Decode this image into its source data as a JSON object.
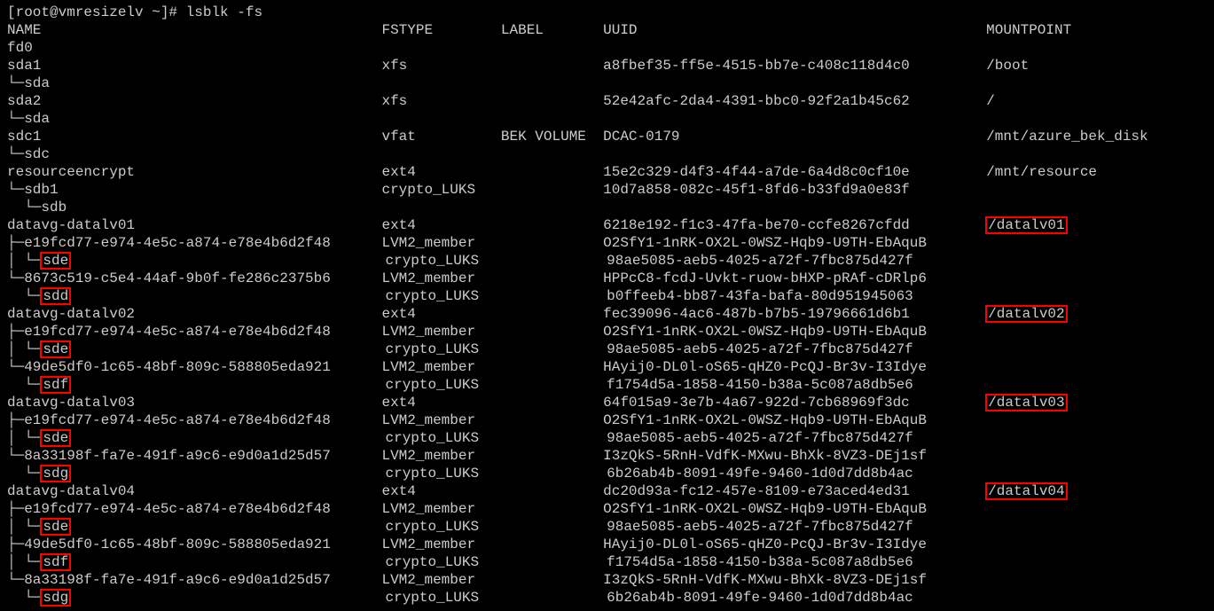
{
  "prompt": "[root@vmresizelv ~]# lsblk -fs",
  "header": {
    "name": "NAME",
    "fstype": "FSTYPE",
    "label": "LABEL",
    "uuid": "UUID",
    "mount": "MOUNTPOINT"
  },
  "rows": [
    {
      "tree": "fd0",
      "fstype": "",
      "label": "",
      "uuid": "",
      "mount": "",
      "hl_name": false,
      "hl_mount": false
    },
    {
      "tree": "sda1",
      "fstype": "xfs",
      "label": "",
      "uuid": "a8fbef35-ff5e-4515-bb7e-c408c118d4c0",
      "mount": "/boot",
      "hl_name": false,
      "hl_mount": false
    },
    {
      "tree": "└─sda",
      "fstype": "",
      "label": "",
      "uuid": "",
      "mount": "",
      "hl_name": false,
      "hl_mount": false
    },
    {
      "tree": "sda2",
      "fstype": "xfs",
      "label": "",
      "uuid": "52e42afc-2da4-4391-bbc0-92f2a1b45c62",
      "mount": "/",
      "hl_name": false,
      "hl_mount": false
    },
    {
      "tree": "└─sda",
      "fstype": "",
      "label": "",
      "uuid": "",
      "mount": "",
      "hl_name": false,
      "hl_mount": false
    },
    {
      "tree": "sdc1",
      "fstype": "vfat",
      "label": "BEK VOLUME",
      "uuid": "DCAC-0179",
      "mount": "/mnt/azure_bek_disk",
      "hl_name": false,
      "hl_mount": false
    },
    {
      "tree": "└─sdc",
      "fstype": "",
      "label": "",
      "uuid": "",
      "mount": "",
      "hl_name": false,
      "hl_mount": false
    },
    {
      "tree": "resourceencrypt",
      "fstype": "ext4",
      "label": "",
      "uuid": "15e2c329-d4f3-4f44-a7de-6a4d8c0cf10e",
      "mount": "/mnt/resource",
      "hl_name": false,
      "hl_mount": false
    },
    {
      "tree": "└─sdb1",
      "fstype": "crypto_LUKS",
      "label": "",
      "uuid": "10d7a858-082c-45f1-8fd6-b33fd9a0e83f",
      "mount": "",
      "hl_name": false,
      "hl_mount": false
    },
    {
      "tree": "  └─sdb",
      "fstype": "",
      "label": "",
      "uuid": "",
      "mount": "",
      "hl_name": false,
      "hl_mount": false
    },
    {
      "tree": "datavg-datalv01",
      "fstype": "ext4",
      "label": "",
      "uuid": "6218e192-f1c3-47fa-be70-ccfe8267cfdd",
      "mount": "/datalv01",
      "hl_name": false,
      "hl_mount": true
    },
    {
      "tree": "├─e19fcd77-e974-4e5c-a874-e78e4b6d2f48",
      "fstype": "LVM2_member",
      "label": "",
      "uuid": "O2SfY1-1nRK-OX2L-0WSZ-Hqb9-U9TH-EbAquB",
      "mount": "",
      "hl_name": false,
      "hl_mount": false
    },
    {
      "tree": "│ └─",
      "dev": "sde",
      "fstype": "crypto_LUKS",
      "label": "",
      "uuid": "98ae5085-aeb5-4025-a72f-7fbc875d427f",
      "mount": "",
      "hl_name": true,
      "hl_mount": false
    },
    {
      "tree": "└─8673c519-c5e4-44af-9b0f-fe286c2375b6",
      "fstype": "LVM2_member",
      "label": "",
      "uuid": "HPPcC8-fcdJ-Uvkt-ruow-bHXP-pRAf-cDRlp6",
      "mount": "",
      "hl_name": false,
      "hl_mount": false
    },
    {
      "tree": "  └─",
      "dev": "sdd",
      "fstype": "crypto_LUKS",
      "label": "",
      "uuid": "b0ffeeb4-bb87-43fa-bafa-80d951945063",
      "mount": "",
      "hl_name": true,
      "hl_mount": false
    },
    {
      "tree": "datavg-datalv02",
      "fstype": "ext4",
      "label": "",
      "uuid": "fec39096-4ac6-487b-b7b5-19796661d6b1",
      "mount": "/datalv02",
      "hl_name": false,
      "hl_mount": true
    },
    {
      "tree": "├─e19fcd77-e974-4e5c-a874-e78e4b6d2f48",
      "fstype": "LVM2_member",
      "label": "",
      "uuid": "O2SfY1-1nRK-OX2L-0WSZ-Hqb9-U9TH-EbAquB",
      "mount": "",
      "hl_name": false,
      "hl_mount": false
    },
    {
      "tree": "│ └─",
      "dev": "sde",
      "fstype": "crypto_LUKS",
      "label": "",
      "uuid": "98ae5085-aeb5-4025-a72f-7fbc875d427f",
      "mount": "",
      "hl_name": true,
      "hl_mount": false
    },
    {
      "tree": "└─49de5df0-1c65-48bf-809c-588805eda921",
      "fstype": "LVM2_member",
      "label": "",
      "uuid": "HAyij0-DL0l-oS65-qHZ0-PcQJ-Br3v-I3Idye",
      "mount": "",
      "hl_name": false,
      "hl_mount": false
    },
    {
      "tree": "  └─",
      "dev": "sdf",
      "fstype": "crypto_LUKS",
      "label": "",
      "uuid": "f1754d5a-1858-4150-b38a-5c087a8db5e6",
      "mount": "",
      "hl_name": true,
      "hl_mount": false
    },
    {
      "tree": "datavg-datalv03",
      "fstype": "ext4",
      "label": "",
      "uuid": "64f015a9-3e7b-4a67-922d-7cb68969f3dc",
      "mount": "/datalv03",
      "hl_name": false,
      "hl_mount": true
    },
    {
      "tree": "├─e19fcd77-e974-4e5c-a874-e78e4b6d2f48",
      "fstype": "LVM2_member",
      "label": "",
      "uuid": "O2SfY1-1nRK-OX2L-0WSZ-Hqb9-U9TH-EbAquB",
      "mount": "",
      "hl_name": false,
      "hl_mount": false
    },
    {
      "tree": "│ └─",
      "dev": "sde",
      "fstype": "crypto_LUKS",
      "label": "",
      "uuid": "98ae5085-aeb5-4025-a72f-7fbc875d427f",
      "mount": "",
      "hl_name": true,
      "hl_mount": false
    },
    {
      "tree": "└─8a33198f-fa7e-491f-a9c6-e9d0a1d25d57",
      "fstype": "LVM2_member",
      "label": "",
      "uuid": "I3zQkS-5RnH-VdfK-MXwu-BhXk-8VZ3-DEj1sf",
      "mount": "",
      "hl_name": false,
      "hl_mount": false
    },
    {
      "tree": "  └─",
      "dev": "sdg",
      "fstype": "crypto_LUKS",
      "label": "",
      "uuid": "6b26ab4b-8091-49fe-9460-1d0d7dd8b4ac",
      "mount": "",
      "hl_name": true,
      "hl_mount": false
    },
    {
      "tree": "datavg-datalv04",
      "fstype": "ext4",
      "label": "",
      "uuid": "dc20d93a-fc12-457e-8109-e73aced4ed31",
      "mount": "/datalv04",
      "hl_name": false,
      "hl_mount": true
    },
    {
      "tree": "├─e19fcd77-e974-4e5c-a874-e78e4b6d2f48",
      "fstype": "LVM2_member",
      "label": "",
      "uuid": "O2SfY1-1nRK-OX2L-0WSZ-Hqb9-U9TH-EbAquB",
      "mount": "",
      "hl_name": false,
      "hl_mount": false
    },
    {
      "tree": "│ └─",
      "dev": "sde",
      "fstype": "crypto_LUKS",
      "label": "",
      "uuid": "98ae5085-aeb5-4025-a72f-7fbc875d427f",
      "mount": "",
      "hl_name": true,
      "hl_mount": false
    },
    {
      "tree": "├─49de5df0-1c65-48bf-809c-588805eda921",
      "fstype": "LVM2_member",
      "label": "",
      "uuid": "HAyij0-DL0l-oS65-qHZ0-PcQJ-Br3v-I3Idye",
      "mount": "",
      "hl_name": false,
      "hl_mount": false
    },
    {
      "tree": "│ └─",
      "dev": "sdf",
      "fstype": "crypto_LUKS",
      "label": "",
      "uuid": "f1754d5a-1858-4150-b38a-5c087a8db5e6",
      "mount": "",
      "hl_name": true,
      "hl_mount": false
    },
    {
      "tree": "└─8a33198f-fa7e-491f-a9c6-e9d0a1d25d57",
      "fstype": "LVM2_member",
      "label": "",
      "uuid": "I3zQkS-5RnH-VdfK-MXwu-BhXk-8VZ3-DEj1sf",
      "mount": "",
      "hl_name": false,
      "hl_mount": false
    },
    {
      "tree": "  └─",
      "dev": "sdg",
      "fstype": "crypto_LUKS",
      "label": "",
      "uuid": "6b26ab4b-8091-49fe-9460-1d0d7dd8b4ac",
      "mount": "",
      "hl_name": true,
      "hl_mount": false
    }
  ],
  "cols": {
    "name": 44,
    "fstype": 14,
    "label": 12,
    "uuid": 45
  }
}
